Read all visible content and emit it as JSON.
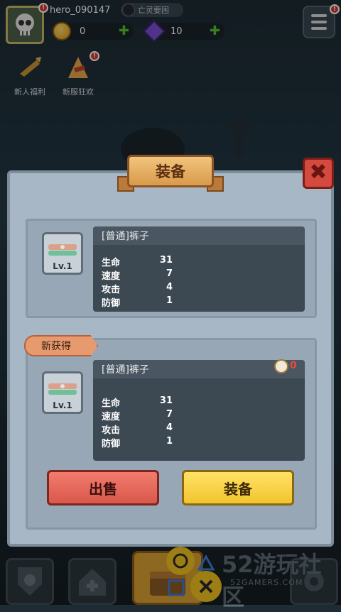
{
  "hud": {
    "player_name": "hero_090147",
    "title_label": "亡灵要困",
    "gold": "0",
    "gems": "10",
    "avatar_badge": "!",
    "menu_badge": "!"
  },
  "events": [
    {
      "label": "新人福利"
    },
    {
      "label": "新服狂欢",
      "badge": "!"
    }
  ],
  "dialog": {
    "title": "装备",
    "current": {
      "item_name": "[普通]裤子",
      "level": "Lv.1",
      "stats": [
        {
          "label": "生命",
          "value": "31"
        },
        {
          "label": "速度",
          "value": "7"
        },
        {
          "label": "攻击",
          "value": "4"
        },
        {
          "label": "防御",
          "value": "1"
        }
      ]
    },
    "new_tag": "新获得",
    "new": {
      "item_name": "[普通]裤子",
      "level": "Lv.1",
      "power": "0",
      "stats": [
        {
          "label": "生命",
          "value": "31"
        },
        {
          "label": "速度",
          "value": "7"
        },
        {
          "label": "攻击",
          "value": "4"
        },
        {
          "label": "防御",
          "value": "1"
        }
      ]
    },
    "sell_label": "出售",
    "equip_label": "装备"
  },
  "watermark": {
    "number": "52",
    "text": "游玩社区",
    "domain": "52GAMERS.COM"
  },
  "colors": {
    "panel": "#a8b7c5",
    "sell_button": "#e56a5d",
    "equip_button": "#f8d548",
    "power_value": "#e74a3b"
  }
}
